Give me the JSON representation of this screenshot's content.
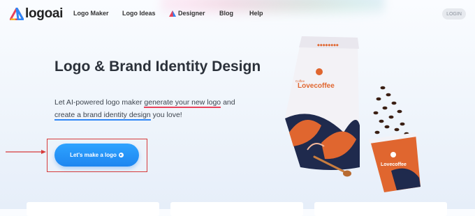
{
  "nav": {
    "logo_text": "logoai",
    "items": [
      "Logo Maker",
      "Logo Ideas",
      "Designer",
      "Blog",
      "Help"
    ],
    "login": "LOGIN"
  },
  "hero": {
    "title": "Logo & Brand Identity Design",
    "subtitle_pre": "Let AI-powered logo maker ",
    "highlight_1": "generate your new logo",
    "subtitle_mid": " and ",
    "highlight_2": "create a brand identity design",
    "subtitle_post": " you love!",
    "cta_label": "Let's make a logo",
    "cta_icon": "arrow-circle-right-icon"
  },
  "product": {
    "brand_small": "Coffee",
    "brand": "Lovecoffee"
  },
  "colors": {
    "accent_blue": "#1e86f0",
    "accent_red": "#e8435b",
    "annotation_red": "#d63a3a",
    "bag_orange": "#e0662f",
    "bag_navy": "#1f2a4d"
  }
}
